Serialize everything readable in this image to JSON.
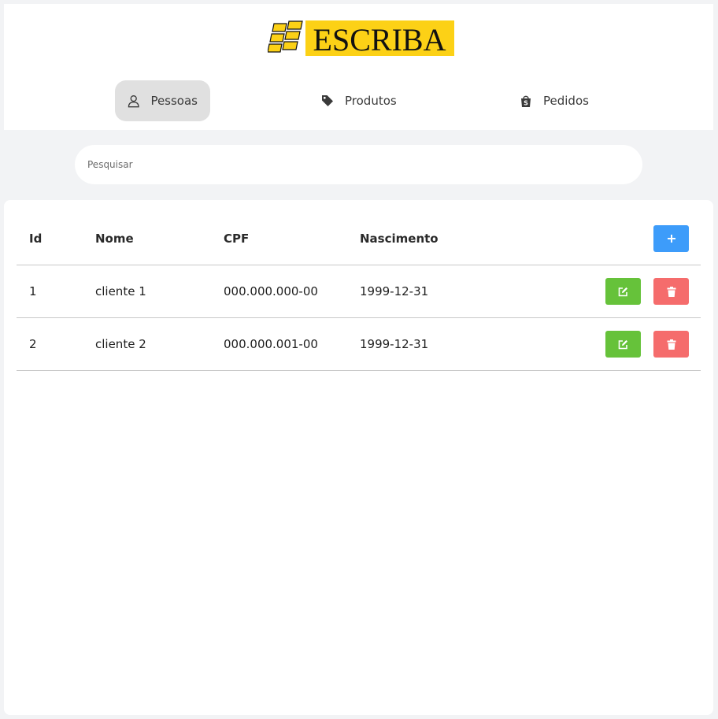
{
  "header": {
    "logo_text": "ESCRIBA",
    "nav": [
      {
        "label": "Pessoas",
        "icon": "user-icon",
        "active": true
      },
      {
        "label": "Produtos",
        "icon": "tag-icon",
        "active": false
      },
      {
        "label": "Pedidos",
        "icon": "shopping-bag-icon",
        "active": false
      }
    ]
  },
  "search": {
    "placeholder": "Pesquisar",
    "value": ""
  },
  "table": {
    "columns": [
      "Id",
      "Nome",
      "CPF",
      "Nascimento"
    ],
    "add_button_icon": "plus-icon",
    "rows": [
      {
        "id": "1",
        "nome": "cliente 1",
        "cpf": "000.000.000-00",
        "nascimento": "1999-12-31"
      },
      {
        "id": "2",
        "nome": "cliente 2",
        "cpf": "000.000.001-00",
        "nascimento": "1999-12-31"
      }
    ],
    "row_action_icons": [
      "edit-icon",
      "trash-icon"
    ]
  },
  "colors": {
    "add": "#3d9cfa",
    "edit": "#66c23a",
    "delete": "#f56c6c",
    "logo_yellow": "#fcd116",
    "active_nav_bg": "#e0e0e0"
  }
}
